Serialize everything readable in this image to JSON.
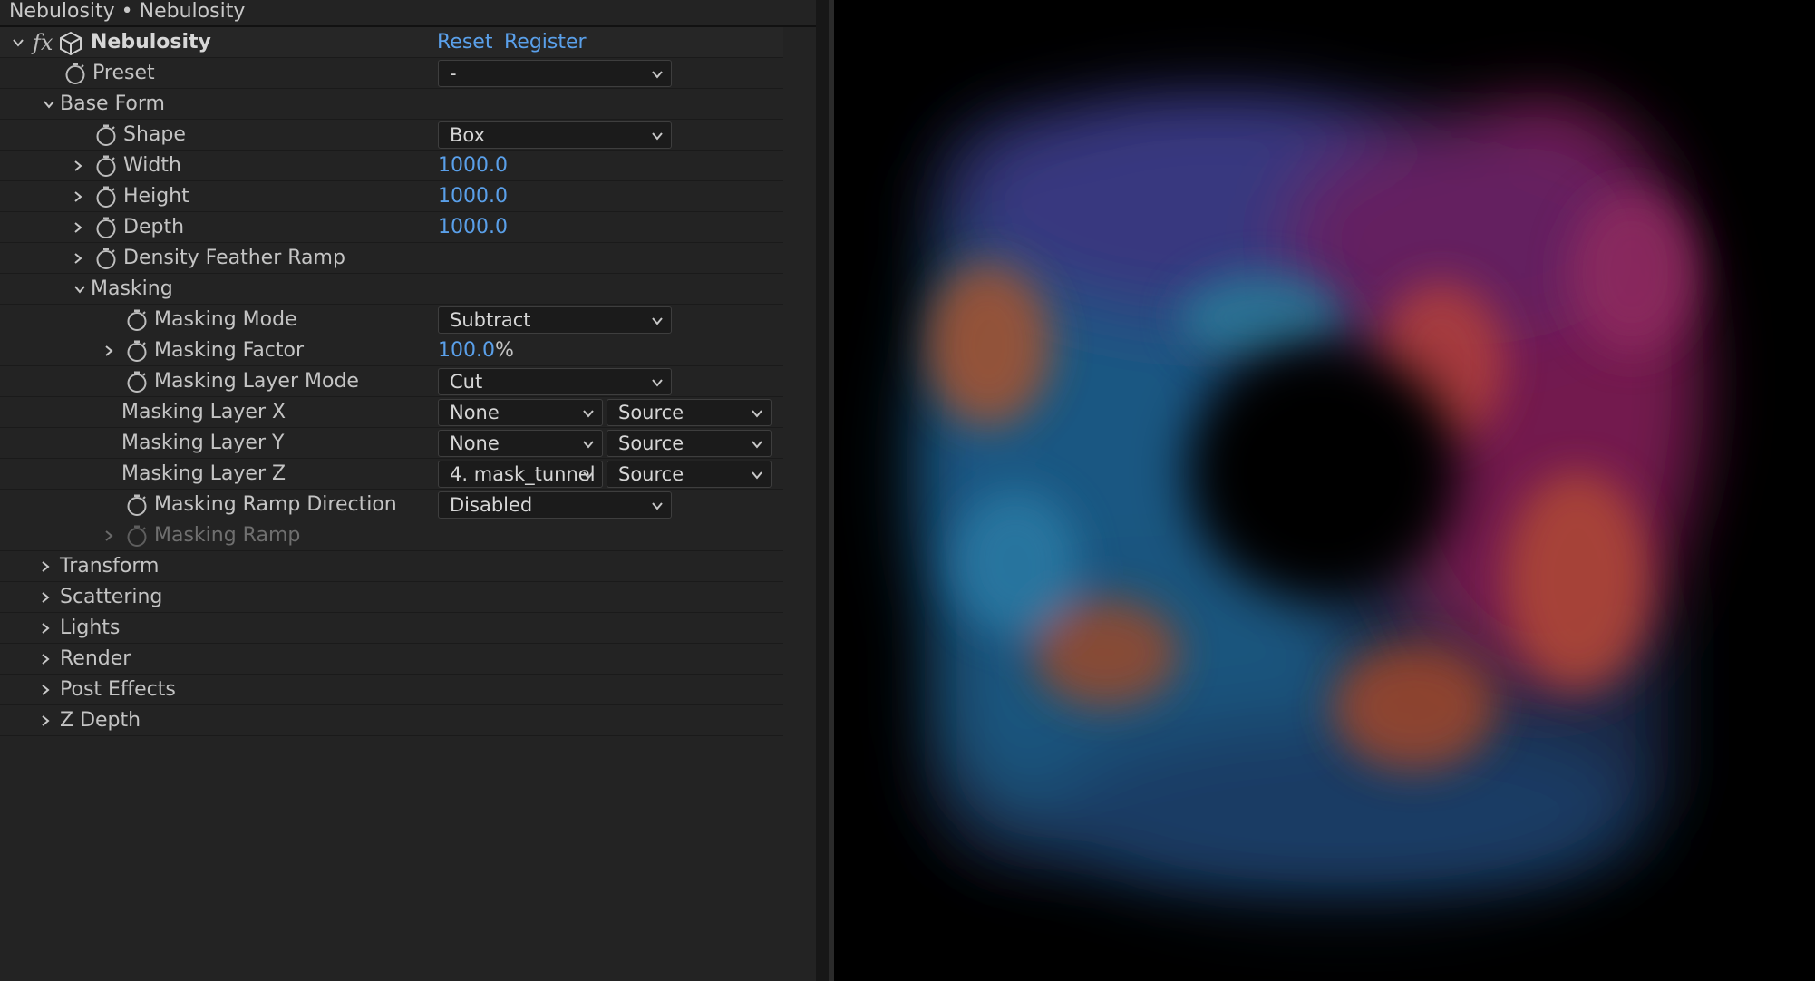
{
  "panel": {
    "title": "Nebulosity • Nebulosity",
    "effect": {
      "name": "Nebulosity",
      "fx_label": "fx",
      "reset_label": "Reset",
      "register_label": "Register"
    },
    "preset": {
      "label": "Preset",
      "value": "-"
    },
    "base_form": {
      "label": "Base Form",
      "shape": {
        "label": "Shape",
        "value": "Box"
      },
      "width": {
        "label": "Width",
        "value": "1000.0"
      },
      "height": {
        "label": "Height",
        "value": "1000.0"
      },
      "depth": {
        "label": "Depth",
        "value": "1000.0"
      },
      "density_feather_ramp": {
        "label": "Density Feather Ramp"
      },
      "masking": {
        "label": "Masking",
        "mode": {
          "label": "Masking Mode",
          "value": "Subtract"
        },
        "factor": {
          "label": "Masking Factor",
          "value": "100.0",
          "unit": "%"
        },
        "layer_mode": {
          "label": "Masking Layer Mode",
          "value": "Cut"
        },
        "layer_x": {
          "label": "Masking Layer X",
          "layer": "None",
          "source": "Source"
        },
        "layer_y": {
          "label": "Masking Layer Y",
          "layer": "None",
          "source": "Source"
        },
        "layer_z": {
          "label": "Masking Layer Z",
          "layer": "4. mask_tunnel",
          "source": "Source"
        },
        "ramp_direction": {
          "label": "Masking Ramp Direction",
          "value": "Disabled"
        },
        "ramp": {
          "label": "Masking Ramp"
        }
      }
    },
    "groups": {
      "transform": "Transform",
      "scattering": "Scattering",
      "lights": "Lights",
      "render": "Render",
      "post_effects": "Post Effects",
      "z_depth": "Z Depth"
    }
  },
  "colors": {
    "accent_blue": "#5aa0ea",
    "panel_bg": "#232323",
    "viewer_bg": "#000000"
  },
  "icons": [
    "stopwatch-icon",
    "chevron-down-icon",
    "chevron-right-icon",
    "cube-icon",
    "fx-icon"
  ]
}
